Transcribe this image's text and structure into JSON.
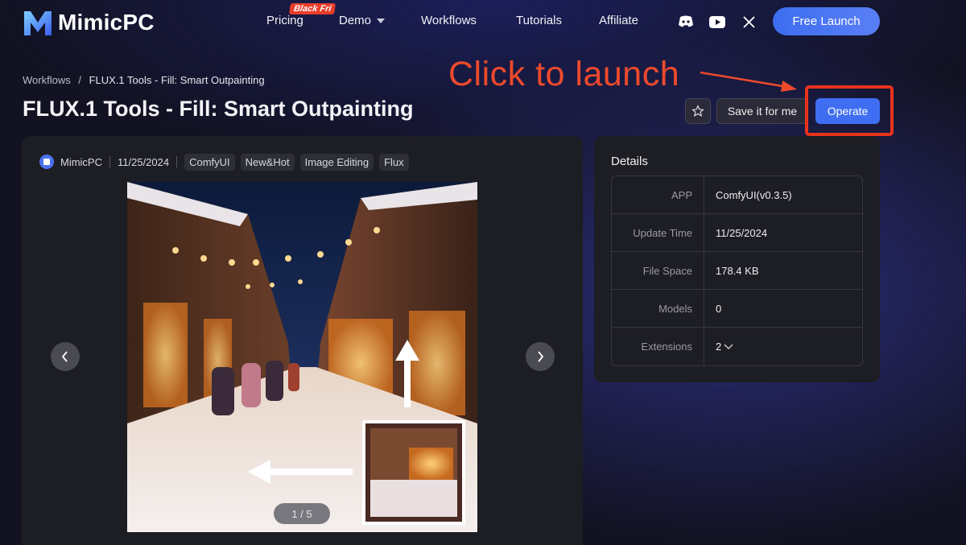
{
  "nav": {
    "brand": "MimicPC",
    "links": {
      "pricing": "Pricing",
      "demo": "Demo",
      "workflows": "Workflows",
      "tutorials": "Tutorials",
      "affiliate": "Affiliate"
    },
    "promo_badge": "Black Fri",
    "free_launch": "Free Launch"
  },
  "breadcrumb": {
    "parent": "Workflows",
    "separator": "/",
    "current": "FLUX.1 Tools - Fill: Smart Outpainting"
  },
  "page_title": "FLUX.1 Tools - Fill: Smart Outpainting",
  "annotation": {
    "text": "Click to launch",
    "color": "#ee4a2c"
  },
  "actions": {
    "save": "Save it for me",
    "operate": "Operate"
  },
  "meta": {
    "author": "MimicPC",
    "date": "11/25/2024",
    "tags": [
      "ComfyUI",
      "New&Hot",
      "Image Editing",
      "Flux"
    ]
  },
  "carousel": {
    "counter": "1 / 5"
  },
  "details": {
    "title": "Details",
    "rows": [
      {
        "key": "APP",
        "value": "ComfyUI(v0.3.5)"
      },
      {
        "key": "Update Time",
        "value": "11/25/2024"
      },
      {
        "key": "File Space",
        "value": "178.4 KB"
      },
      {
        "key": "Models",
        "value": "0"
      },
      {
        "key": "Extensions",
        "value": "2"
      }
    ]
  },
  "colors": {
    "accent": "#3f6ef2",
    "highlight": "#e8331d",
    "card": "#1d1d24"
  }
}
